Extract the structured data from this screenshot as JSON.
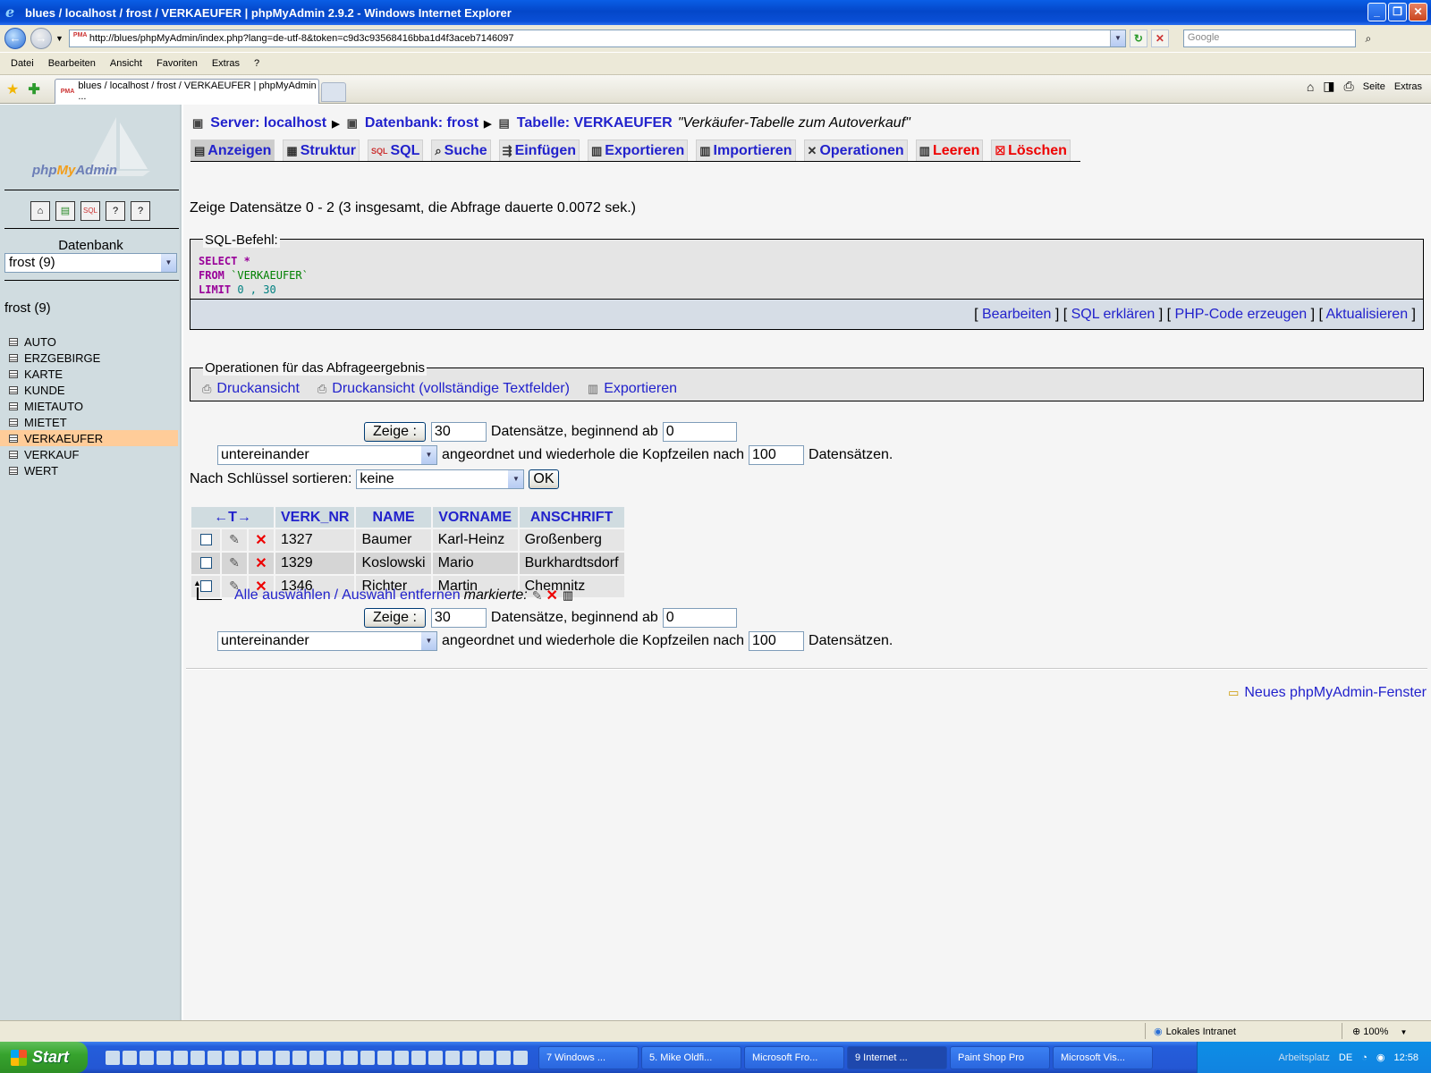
{
  "window": {
    "title": "blues / localhost / frost / VERKAEUFER | phpMyAdmin 2.9.2 - Windows Internet Explorer",
    "url": "http://blues/phpMyAdmin/index.php?lang=de-utf-8&token=c9d3c93568416bba1d4f3aceb7146097",
    "search_placeholder": "Google",
    "menu": [
      "Datei",
      "Bearbeiten",
      "Ansicht",
      "Favoriten",
      "Extras",
      "?"
    ],
    "tab_title": "blues / localhost / frost / VERKAEUFER | phpMyAdmin ...",
    "cmd_page": "Seite",
    "cmd_extras": "Extras"
  },
  "sidebar": {
    "logo_php": "php",
    "logo_my": "My",
    "logo_admin": "Admin",
    "db_label": "Datenbank",
    "db_select": "frost (9)",
    "db_name": "frost (9)",
    "tables": [
      "AUTO",
      "ERZGEBIRGE",
      "KARTE",
      "KUNDE",
      "MIETAUTO",
      "MIETET",
      "VERKAEUFER",
      "VERKAUF",
      "WERT"
    ],
    "active_table": "VERKAEUFER"
  },
  "breadcrumb": {
    "server": "Server: localhost",
    "database": "Datenbank: frost",
    "table": "Tabelle: VERKAEUFER",
    "comment": "\"Verkäufer-Tabelle zum Autoverkauf\""
  },
  "tabs": [
    {
      "label": "Anzeigen"
    },
    {
      "label": "Struktur"
    },
    {
      "label": "SQL"
    },
    {
      "label": "Suche"
    },
    {
      "label": "Einfügen"
    },
    {
      "label": "Exportieren"
    },
    {
      "label": "Importieren"
    },
    {
      "label": "Operationen"
    },
    {
      "label": "Leeren"
    },
    {
      "label": "Löschen"
    }
  ],
  "status_text": "Zeige Datensätze 0 - 2 (3 insgesamt, die Abfrage dauerte 0.0072 sek.)",
  "sql": {
    "legend": "SQL-Befehl:",
    "select": "SELECT",
    "star": "*",
    "from": "FROM",
    "table": "`VERKAEUFER`",
    "limit": "LIMIT",
    "limit_vals": "0 , 30",
    "links": {
      "edit": "Bearbeiten",
      "explain": "SQL erklären",
      "php": "PHP-Code erzeugen",
      "refresh": "Aktualisieren"
    }
  },
  "ops": {
    "legend": "Operationen für das Abfrageergebnis",
    "print": "Druckansicht",
    "print_full": "Druckansicht (vollständige Textfelder)",
    "export": "Exportieren"
  },
  "nav": {
    "show_btn": "Zeige :",
    "rows_top": "30",
    "rows_bottom": "30",
    "start_label": "Datensätze, beginnend ab",
    "start_value": "0",
    "mode": "untereinander",
    "repeat_label": "angeordnet und wiederhole die Kopfzeilen nach",
    "repeat_value": "100",
    "repeat_suffix": "Datensätzen."
  },
  "sort": {
    "label": "Nach Schlüssel sortieren:",
    "value": "keine",
    "ok": "OK"
  },
  "table": {
    "arrows": "←T→",
    "columns": [
      "VERK_NR",
      "NAME",
      "VORNAME",
      "ANSCHRIFT"
    ],
    "rows": [
      [
        "1327",
        "Baumer",
        "Karl-Heinz",
        "Großenberg"
      ],
      [
        "1329",
        "Koslowski",
        "Mario",
        "Burkhardtsdorf"
      ],
      [
        "1346",
        "Richter",
        "Martin",
        "Chemnitz"
      ]
    ]
  },
  "check": {
    "all": "Alle auswählen",
    "sep": "/",
    "none": "Auswahl entfernen",
    "marked": "markierte:"
  },
  "new_window": "Neues phpMyAdmin-Fenster",
  "statusbar": {
    "zone": "Lokales Intranet",
    "zoom": "100%"
  },
  "taskbar": {
    "start": "Start",
    "tasks": [
      "7 Windows ...",
      "5. Mike Oldfi...",
      "Microsoft Fro...",
      "9 Internet ...",
      "Paint Shop Pro",
      "Microsoft Vis..."
    ],
    "active_task": 3,
    "tray_label": "Arbeitsplatz",
    "lang": "DE",
    "clock": "12:58"
  }
}
